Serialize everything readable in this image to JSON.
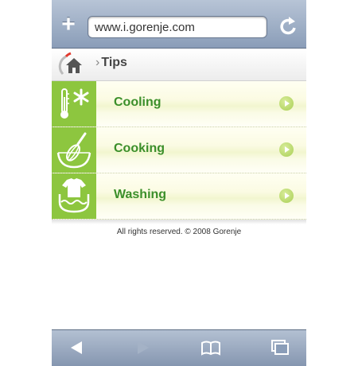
{
  "browser": {
    "url": "www.i.gorenje.com",
    "new_tab_symbol": "+"
  },
  "breadcrumb": {
    "separator": "›",
    "current": "Tips"
  },
  "menu": {
    "items": [
      {
        "label": "Cooling",
        "icon": "thermometer-snowflake-icon"
      },
      {
        "label": "Cooking",
        "icon": "whisk-bowl-icon"
      },
      {
        "label": "Washing",
        "icon": "shirt-water-icon"
      }
    ]
  },
  "footer": {
    "text": "All rights reserved. © 2008 Gorenje"
  },
  "colors": {
    "accent_green": "#8dc63f",
    "label_green": "#3b8f2a",
    "toolbar_blue": "#8a9db8"
  }
}
